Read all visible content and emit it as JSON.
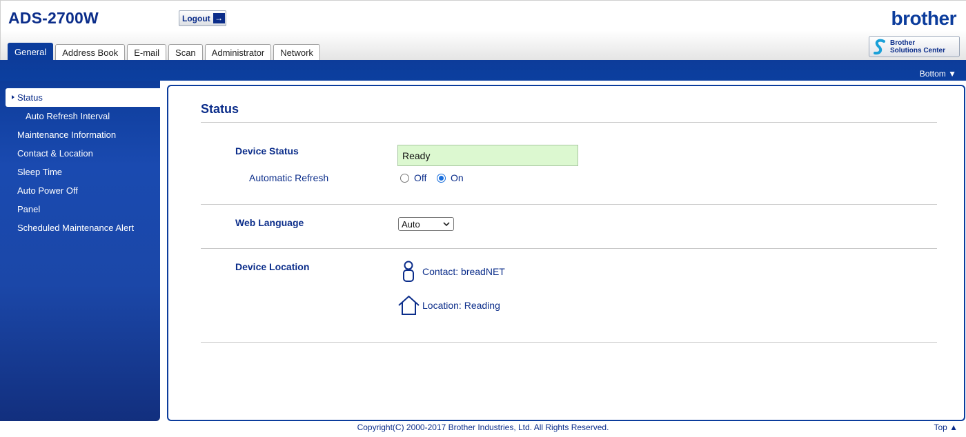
{
  "header": {
    "model": "ADS-2700W",
    "logout_label": "Logout",
    "brand": "brother",
    "solutions_center_line1": "Brother",
    "solutions_center_line2": "Solutions Center"
  },
  "tabs": [
    {
      "label": "General",
      "active": true
    },
    {
      "label": "Address Book",
      "active": false
    },
    {
      "label": "E-mail",
      "active": false
    },
    {
      "label": "Scan",
      "active": false
    },
    {
      "label": "Administrator",
      "active": false
    },
    {
      "label": "Network",
      "active": false
    }
  ],
  "bottom_link": "Bottom ▼",
  "sidebar": {
    "items": [
      {
        "label": "Status",
        "active": true
      },
      {
        "label": "Auto Refresh Interval",
        "sub": true
      },
      {
        "label": "Maintenance Information"
      },
      {
        "label": "Contact & Location"
      },
      {
        "label": "Sleep Time"
      },
      {
        "label": "Auto Power Off"
      },
      {
        "label": "Panel"
      },
      {
        "label": "Scheduled Maintenance Alert"
      }
    ]
  },
  "main": {
    "title": "Status",
    "device_status_label": "Device Status",
    "device_status_value": "Ready",
    "auto_refresh_label": "Automatic Refresh",
    "auto_refresh_off": "Off",
    "auto_refresh_on": "On",
    "auto_refresh_selected": "On",
    "web_language_label": "Web Language",
    "web_language_value": "Auto",
    "device_location_label": "Device Location",
    "contact": "Contact: breadNET",
    "location": "Location: Reading"
  },
  "footer": {
    "copyright": "Copyright(C) 2000-2017 Brother Industries, Ltd. All Rights Reserved.",
    "top_link": "Top ▲"
  },
  "colors": {
    "brand_blue": "#0b3c9c",
    "text_blue": "#0b2d8a",
    "status_green": "#dcf8d0"
  }
}
